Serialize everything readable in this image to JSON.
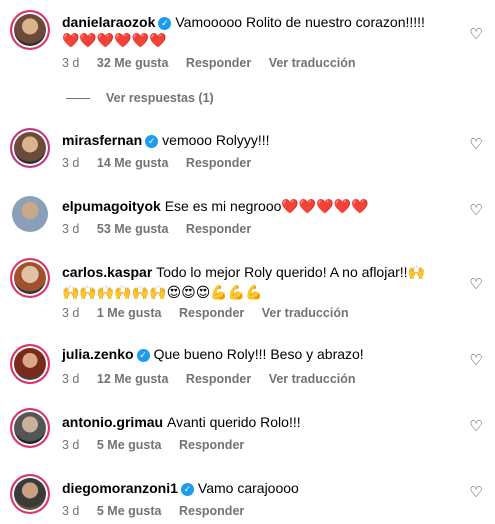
{
  "comments": [
    {
      "username": "danielaraozok",
      "verified": true,
      "text": "Vamooooo Rolito de nuestro corazon!!!!!",
      "text_line2": "❤️❤️❤️❤️❤️❤️",
      "time": "3 d",
      "likes": "32 Me gusta",
      "reply_label": "Responder",
      "translate_label": "Ver traducción",
      "view_replies_label": "Ver respuestas (1)"
    },
    {
      "username": "mirasfernan",
      "verified": true,
      "text": "vemooo Rolyyy!!!",
      "time": "3 d",
      "likes": "14 Me gusta",
      "reply_label": "Responder"
    },
    {
      "username": "elpumagoityok",
      "verified": false,
      "text": "Ese es mi negrooo❤️❤️❤️❤️❤️",
      "time": "3 d",
      "likes": "53 Me gusta",
      "reply_label": "Responder"
    },
    {
      "username": "carlos.kaspar",
      "verified": false,
      "text": "Todo lo mejor Roly querido! A no aflojar!!🙌",
      "text_line2": "🙌🙌🙌🙌🙌🙌😍😍😍💪💪💪",
      "time": "3 d",
      "likes": "1 Me gusta",
      "reply_label": "Responder",
      "translate_label": "Ver traducción"
    },
    {
      "username": "julia.zenko",
      "verified": true,
      "text": "Que bueno Roly!!! Beso y abrazo!",
      "time": "3 d",
      "likes": "12 Me gusta",
      "reply_label": "Responder",
      "translate_label": "Ver traducción"
    },
    {
      "username": "antonio.grimau",
      "verified": false,
      "text": "Avanti querido Rolo!!!",
      "time": "3 d",
      "likes": "5 Me gusta",
      "reply_label": "Responder"
    },
    {
      "username": "diegomoranzoni1",
      "verified": true,
      "text": "Vamo carajoooo",
      "time": "3 d",
      "likes": "5 Me gusta",
      "reply_label": "Responder"
    }
  ],
  "icons": {
    "like": "heart-outline-icon",
    "verified": "verified-badge-icon"
  },
  "colors": {
    "verified": "#1d9bf0",
    "meta_text": "#737373",
    "heart": "#e0245e"
  }
}
